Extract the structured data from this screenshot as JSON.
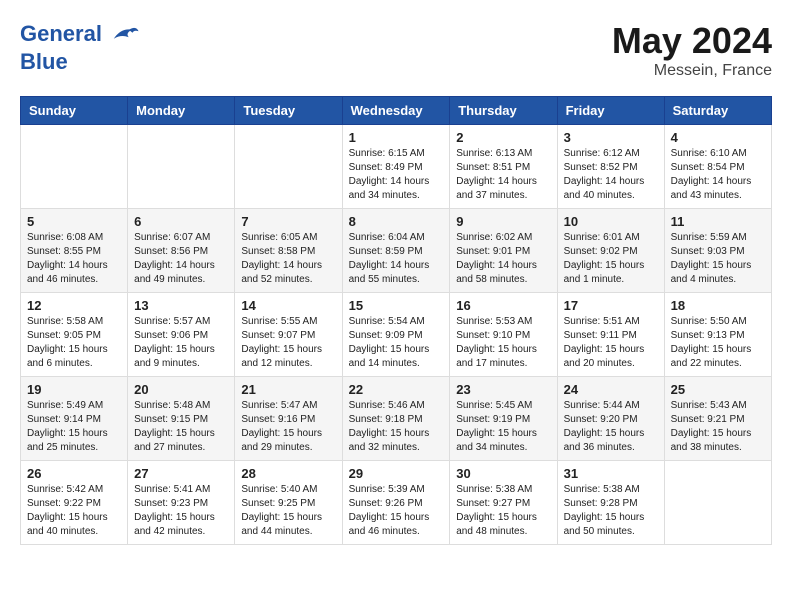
{
  "header": {
    "logo_line1": "General",
    "logo_line2": "Blue",
    "month": "May 2024",
    "location": "Messein, France"
  },
  "weekdays": [
    "Sunday",
    "Monday",
    "Tuesday",
    "Wednesday",
    "Thursday",
    "Friday",
    "Saturday"
  ],
  "weeks": [
    [
      {
        "day": "",
        "info": ""
      },
      {
        "day": "",
        "info": ""
      },
      {
        "day": "",
        "info": ""
      },
      {
        "day": "1",
        "info": "Sunrise: 6:15 AM\nSunset: 8:49 PM\nDaylight: 14 hours\nand 34 minutes."
      },
      {
        "day": "2",
        "info": "Sunrise: 6:13 AM\nSunset: 8:51 PM\nDaylight: 14 hours\nand 37 minutes."
      },
      {
        "day": "3",
        "info": "Sunrise: 6:12 AM\nSunset: 8:52 PM\nDaylight: 14 hours\nand 40 minutes."
      },
      {
        "day": "4",
        "info": "Sunrise: 6:10 AM\nSunset: 8:54 PM\nDaylight: 14 hours\nand 43 minutes."
      }
    ],
    [
      {
        "day": "5",
        "info": "Sunrise: 6:08 AM\nSunset: 8:55 PM\nDaylight: 14 hours\nand 46 minutes."
      },
      {
        "day": "6",
        "info": "Sunrise: 6:07 AM\nSunset: 8:56 PM\nDaylight: 14 hours\nand 49 minutes."
      },
      {
        "day": "7",
        "info": "Sunrise: 6:05 AM\nSunset: 8:58 PM\nDaylight: 14 hours\nand 52 minutes."
      },
      {
        "day": "8",
        "info": "Sunrise: 6:04 AM\nSunset: 8:59 PM\nDaylight: 14 hours\nand 55 minutes."
      },
      {
        "day": "9",
        "info": "Sunrise: 6:02 AM\nSunset: 9:01 PM\nDaylight: 14 hours\nand 58 minutes."
      },
      {
        "day": "10",
        "info": "Sunrise: 6:01 AM\nSunset: 9:02 PM\nDaylight: 15 hours\nand 1 minute."
      },
      {
        "day": "11",
        "info": "Sunrise: 5:59 AM\nSunset: 9:03 PM\nDaylight: 15 hours\nand 4 minutes."
      }
    ],
    [
      {
        "day": "12",
        "info": "Sunrise: 5:58 AM\nSunset: 9:05 PM\nDaylight: 15 hours\nand 6 minutes."
      },
      {
        "day": "13",
        "info": "Sunrise: 5:57 AM\nSunset: 9:06 PM\nDaylight: 15 hours\nand 9 minutes."
      },
      {
        "day": "14",
        "info": "Sunrise: 5:55 AM\nSunset: 9:07 PM\nDaylight: 15 hours\nand 12 minutes."
      },
      {
        "day": "15",
        "info": "Sunrise: 5:54 AM\nSunset: 9:09 PM\nDaylight: 15 hours\nand 14 minutes."
      },
      {
        "day": "16",
        "info": "Sunrise: 5:53 AM\nSunset: 9:10 PM\nDaylight: 15 hours\nand 17 minutes."
      },
      {
        "day": "17",
        "info": "Sunrise: 5:51 AM\nSunset: 9:11 PM\nDaylight: 15 hours\nand 20 minutes."
      },
      {
        "day": "18",
        "info": "Sunrise: 5:50 AM\nSunset: 9:13 PM\nDaylight: 15 hours\nand 22 minutes."
      }
    ],
    [
      {
        "day": "19",
        "info": "Sunrise: 5:49 AM\nSunset: 9:14 PM\nDaylight: 15 hours\nand 25 minutes."
      },
      {
        "day": "20",
        "info": "Sunrise: 5:48 AM\nSunset: 9:15 PM\nDaylight: 15 hours\nand 27 minutes."
      },
      {
        "day": "21",
        "info": "Sunrise: 5:47 AM\nSunset: 9:16 PM\nDaylight: 15 hours\nand 29 minutes."
      },
      {
        "day": "22",
        "info": "Sunrise: 5:46 AM\nSunset: 9:18 PM\nDaylight: 15 hours\nand 32 minutes."
      },
      {
        "day": "23",
        "info": "Sunrise: 5:45 AM\nSunset: 9:19 PM\nDaylight: 15 hours\nand 34 minutes."
      },
      {
        "day": "24",
        "info": "Sunrise: 5:44 AM\nSunset: 9:20 PM\nDaylight: 15 hours\nand 36 minutes."
      },
      {
        "day": "25",
        "info": "Sunrise: 5:43 AM\nSunset: 9:21 PM\nDaylight: 15 hours\nand 38 minutes."
      }
    ],
    [
      {
        "day": "26",
        "info": "Sunrise: 5:42 AM\nSunset: 9:22 PM\nDaylight: 15 hours\nand 40 minutes."
      },
      {
        "day": "27",
        "info": "Sunrise: 5:41 AM\nSunset: 9:23 PM\nDaylight: 15 hours\nand 42 minutes."
      },
      {
        "day": "28",
        "info": "Sunrise: 5:40 AM\nSunset: 9:25 PM\nDaylight: 15 hours\nand 44 minutes."
      },
      {
        "day": "29",
        "info": "Sunrise: 5:39 AM\nSunset: 9:26 PM\nDaylight: 15 hours\nand 46 minutes."
      },
      {
        "day": "30",
        "info": "Sunrise: 5:38 AM\nSunset: 9:27 PM\nDaylight: 15 hours\nand 48 minutes."
      },
      {
        "day": "31",
        "info": "Sunrise: 5:38 AM\nSunset: 9:28 PM\nDaylight: 15 hours\nand 50 minutes."
      },
      {
        "day": "",
        "info": ""
      }
    ]
  ]
}
